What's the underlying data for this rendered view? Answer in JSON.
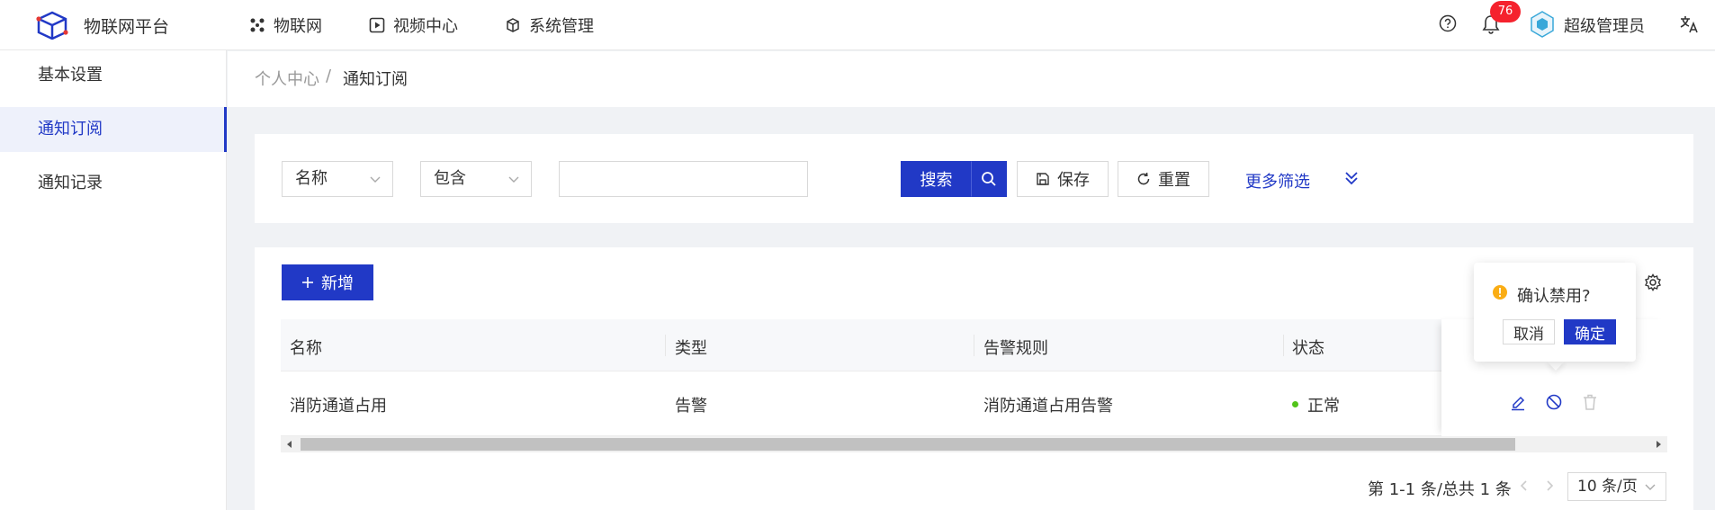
{
  "app": {
    "title": "物联网平台",
    "logo": "cube-logo"
  },
  "nav": [
    {
      "label": "物联网",
      "icon": "cluster-icon"
    },
    {
      "label": "视频中心",
      "icon": "play-square-icon"
    },
    {
      "label": "系统管理",
      "icon": "box-icon"
    }
  ],
  "header": {
    "notification_count": "76",
    "user_name": "超级管理员"
  },
  "sidebar": {
    "items": [
      {
        "label": "基本设置",
        "active": false
      },
      {
        "label": "通知订阅",
        "active": true
      },
      {
        "label": "通知记录",
        "active": false
      }
    ]
  },
  "breadcrumb": {
    "parent": "个人中心",
    "separator": "/",
    "current": "通知订阅"
  },
  "search": {
    "field_select": "名称",
    "operator_select": "包含",
    "value": "",
    "search_label": "搜索",
    "save_label": "保存",
    "reset_label": "重置",
    "more_filter_label": "更多筛选"
  },
  "toolbar": {
    "add_label": "新增"
  },
  "table": {
    "columns": [
      "名称",
      "类型",
      "告警规则",
      "状态"
    ],
    "rows": [
      {
        "name": "消防通道占用",
        "type": "告警",
        "rule": "消防通道占用告警",
        "status": "正常"
      }
    ]
  },
  "popconfirm": {
    "message": "确认禁用?",
    "cancel_label": "取消",
    "ok_label": "确定"
  },
  "pagination": {
    "summary": "第 1-1 条/总共 1 条",
    "page_size": "10 条/页"
  },
  "colors": {
    "primary": "#2139c6",
    "status_ok": "#52c41a",
    "badge": "#f5222d",
    "warning": "#faad14"
  }
}
